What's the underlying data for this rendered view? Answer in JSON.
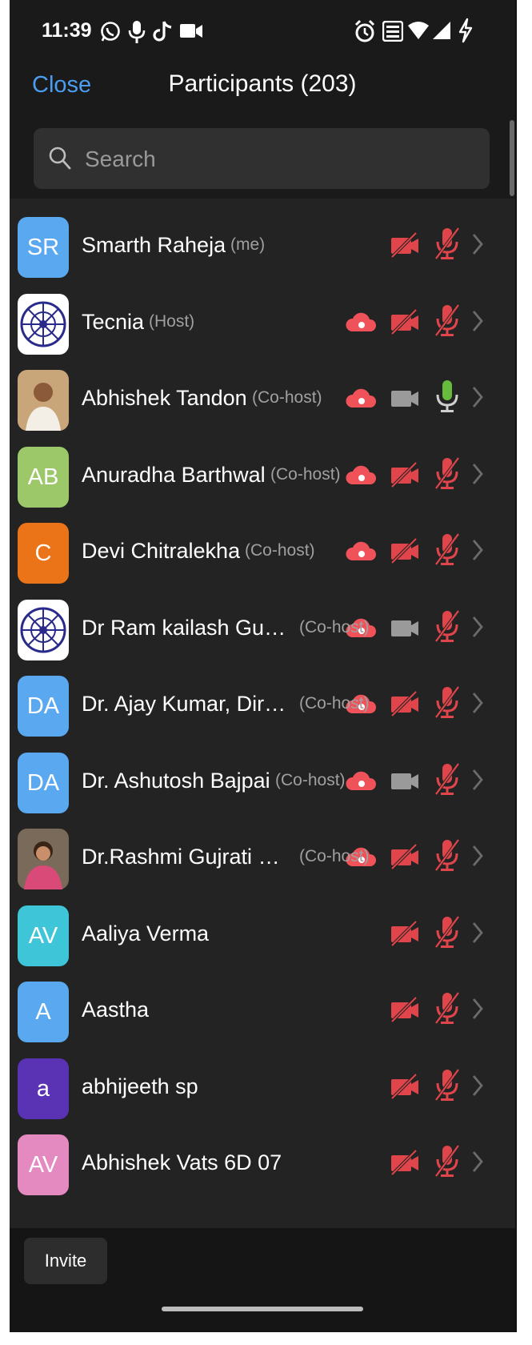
{
  "status_bar": {
    "time": "11:39"
  },
  "nav": {
    "close_label": "Close",
    "title": "Participants (203)"
  },
  "search": {
    "placeholder": "Search"
  },
  "colors": {
    "accent_blue": "#4a9df0",
    "muted_red": "#e0454b",
    "cloud_red": "#f0525a",
    "mic_green": "#66bb3c",
    "video_gray": "#9a9a9a"
  },
  "participants": [
    {
      "name": "Smarth Raheja",
      "role": "(me)",
      "avatar_text": "SR",
      "avatar_color": "#5aa9f0",
      "recording": false,
      "video": "off",
      "audio": "muted"
    },
    {
      "name": "Tecnia",
      "role": "(Host)",
      "avatar_text": "",
      "avatar_icon": "tecnia-logo",
      "recording": true,
      "video": "off",
      "audio": "muted"
    },
    {
      "name": "Abhishek Tandon",
      "role": "(Co-host)",
      "avatar_text": "",
      "avatar_icon": "profile-photo",
      "recording": true,
      "video": "on",
      "audio": "unmuted"
    },
    {
      "name": "Anuradha Barthwal",
      "role": "(Co-host)",
      "avatar_text": "AB",
      "avatar_color": "#9cc86a",
      "recording": true,
      "video": "off",
      "audio": "muted"
    },
    {
      "name": "Devi Chitralekha",
      "role": "(Co-host)",
      "avatar_text": "C",
      "avatar_color": "#ec7418",
      "recording": true,
      "video": "off",
      "audio": "muted"
    },
    {
      "name": "Dr Ram kailash Gup...",
      "role": "(Co-host)",
      "avatar_text": "",
      "avatar_icon": "tecnia-logo",
      "recording": true,
      "video": "on",
      "audio": "muted"
    },
    {
      "name": "Dr. Ajay Kumar, Dire...",
      "role": "(Co-host)",
      "avatar_text": "DA",
      "avatar_color": "#5aa9f0",
      "recording": true,
      "video": "off",
      "audio": "muted"
    },
    {
      "name": "Dr. Ashutosh Bajpai",
      "role": "(Co-host)",
      "avatar_text": "DA",
      "avatar_color": "#5aa9f0",
      "recording": true,
      "video": "on",
      "audio": "muted"
    },
    {
      "name": "Dr.Rashmi Gujrati D...",
      "role": "(Co-host)",
      "avatar_text": "",
      "avatar_icon": "profile-photo",
      "recording": true,
      "video": "off",
      "audio": "muted"
    },
    {
      "name": "Aaliya Verma",
      "role": "",
      "avatar_text": "AV",
      "avatar_color": "#3ec6d8",
      "recording": false,
      "video": "off",
      "audio": "muted"
    },
    {
      "name": "Aastha",
      "role": "",
      "avatar_text": "A",
      "avatar_color": "#5aa9f0",
      "recording": false,
      "video": "off",
      "audio": "muted"
    },
    {
      "name": "abhijeeth sp",
      "role": "",
      "avatar_text": "a",
      "avatar_color": "#5a32b4",
      "recording": false,
      "video": "off",
      "audio": "muted"
    },
    {
      "name": "Abhishek Vats 6D 07",
      "role": "",
      "avatar_text": "AV",
      "avatar_color": "#e48ac0",
      "recording": false,
      "video": "off",
      "audio": "muted"
    }
  ],
  "bottom": {
    "invite_label": "Invite"
  }
}
